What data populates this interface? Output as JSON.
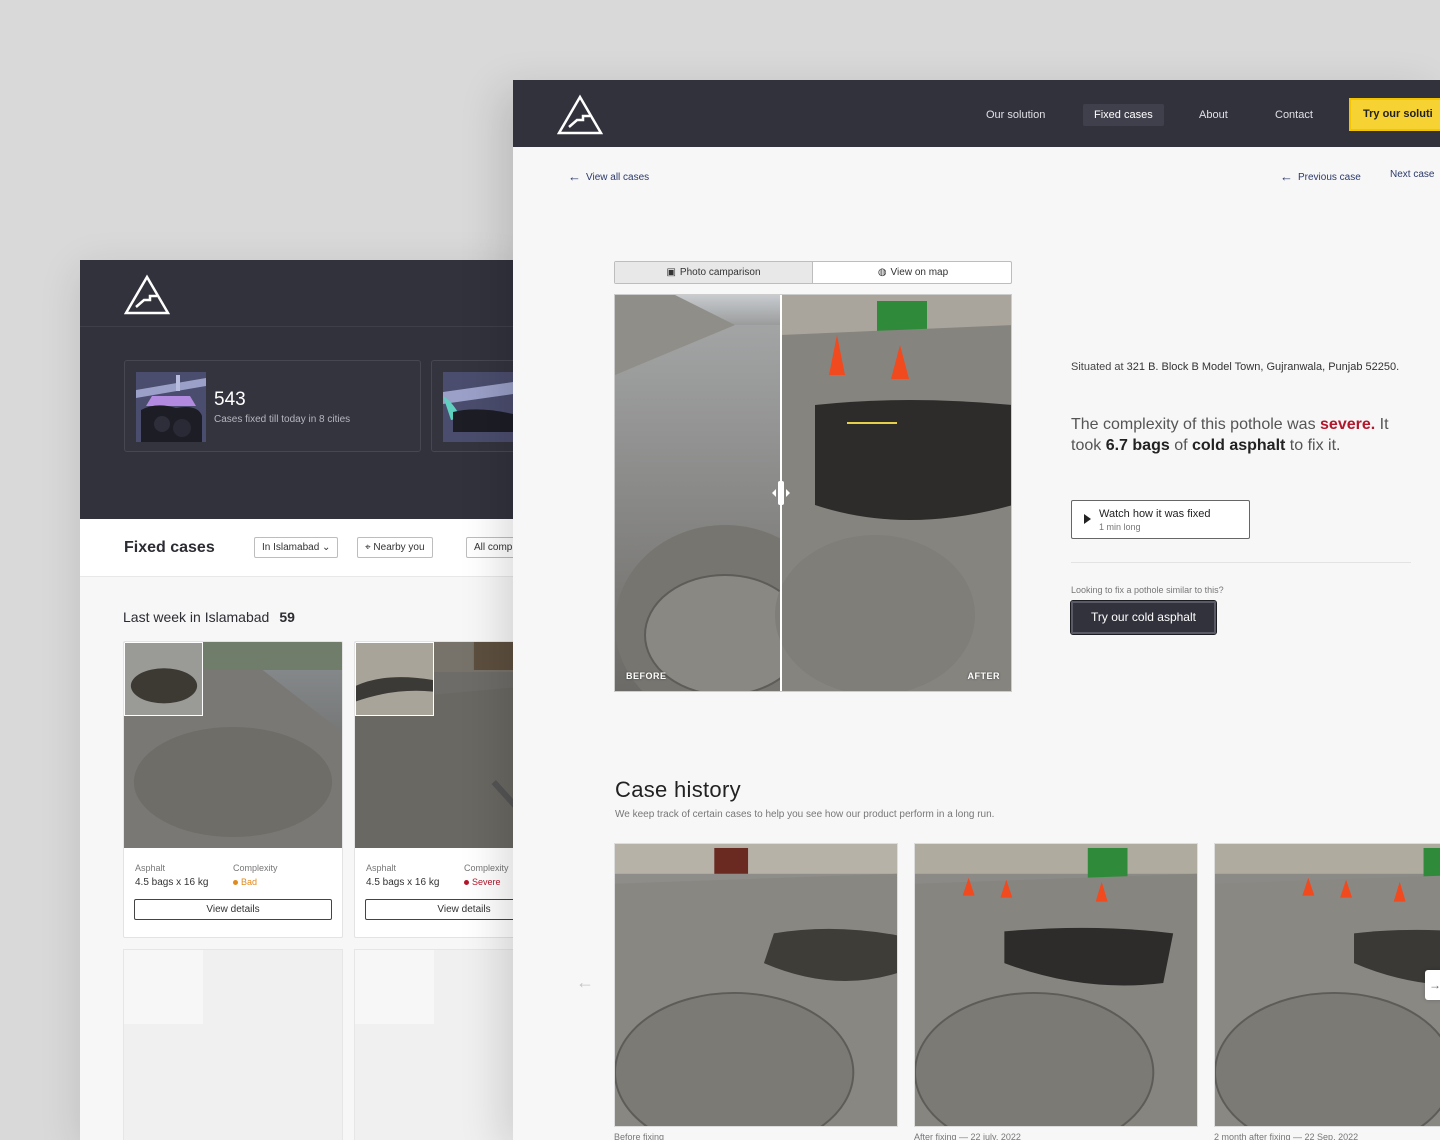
{
  "back_window": {
    "stats": [
      {
        "number": "543",
        "caption": "Cases fixed till today in 8 cities"
      }
    ],
    "filters": {
      "title": "Fixed cases",
      "city": "In Islamabad",
      "nearby": "Nearby you",
      "complexity": "All comp"
    },
    "week": {
      "title": "Last week in Islamabad",
      "count": "59"
    },
    "cases": [
      {
        "material_label": "Asphalt",
        "material_value": "4.5 bags x 16 kg",
        "complexity_label": "Complexity",
        "complexity_value": "Bad",
        "complexity_color": "#e08a1e",
        "button": "View details"
      },
      {
        "material_label": "Asphalt",
        "material_value": "4.5 bags x 16 kg",
        "complexity_label": "Complexity",
        "complexity_value": "Severe",
        "complexity_color": "#b3172c",
        "button": "View details"
      }
    ]
  },
  "nav": {
    "items": [
      "Our solution",
      "Fixed cases",
      "About",
      "Contact"
    ],
    "active": "Fixed cases",
    "cta": "Try our soluti"
  },
  "breadcrumbs": {
    "all": "View all cases",
    "previous": "Previous case",
    "next": "Next case"
  },
  "tabs": {
    "photo": "Photo camparison",
    "map": "View on map"
  },
  "comparison": {
    "before": "BEFORE",
    "after": "AFTER"
  },
  "details": {
    "address_prefix": "Situated at",
    "address": "321 B. Block B Model Town, Gujranwala, Punjab 52250.",
    "complexity_text_1": "The complexity of this pothole was",
    "severity": "severe.",
    "complexity_text_2": "It took",
    "bags": "6.7 bags",
    "complexity_text_3": "of",
    "material": "cold asphalt",
    "complexity_text_4": "to fix it.",
    "watch_title": "Watch how it was fixed",
    "watch_length": "1 min long",
    "looking_text": "Looking to fix a pothole similar to this?",
    "try_button": "Try our cold asphalt"
  },
  "history": {
    "title": "Case history",
    "subtitle": "We keep track of certain cases to help you see how our product perform in a long run.",
    "captions": [
      "Before fixing",
      "After fixing — 22 july, 2022",
      "2 month after fixing — 22 Sep, 2022"
    ]
  },
  "colors": {
    "nav_bg": "#32323d",
    "accent_yellow": "#f7d233",
    "severe_red": "#b3172c",
    "bad_orange": "#e08a1e"
  }
}
